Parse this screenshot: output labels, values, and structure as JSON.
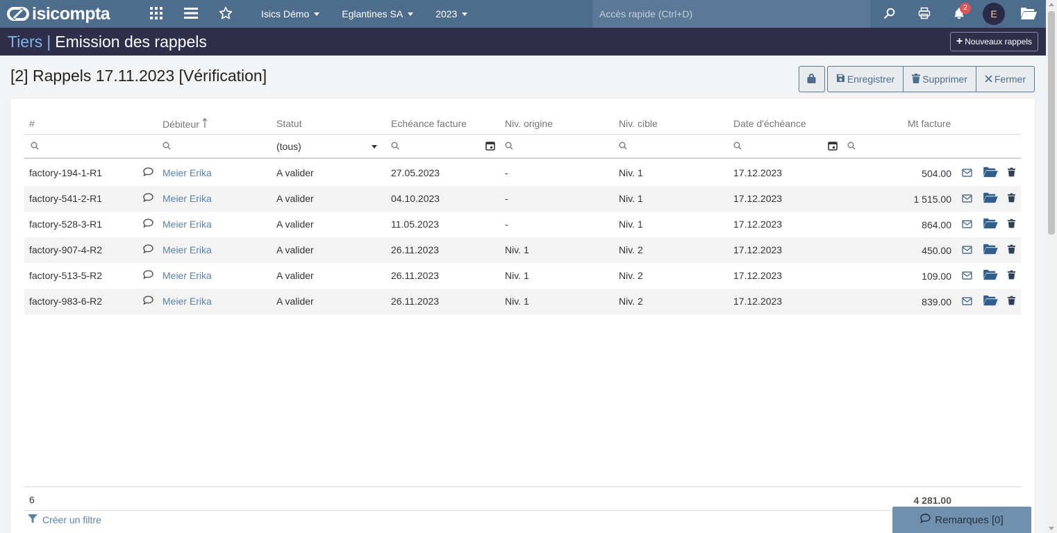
{
  "app": {
    "logo_text": "isicompta"
  },
  "topbar": {
    "dropdowns": [
      "Isics Démo",
      "Eglantines SA",
      "2023"
    ],
    "quick_access_placeholder": "Accès rapide (Ctrl+D)",
    "notification_count": "2",
    "avatar_letter": "E"
  },
  "titlebar": {
    "crumb": "Tiers",
    "separator": "|",
    "title": "Emission des rappels",
    "new_button": "Nouveaux rappels"
  },
  "page": {
    "heading": "[2] Rappels 17.11.2023 [Vérification]"
  },
  "actions": {
    "save": "Enregistrer",
    "delete": "Supprimer",
    "close": "Fermer"
  },
  "table": {
    "columns": [
      "#",
      "Débiteur",
      "Statut",
      "Echéance facture",
      "Niv. origine",
      "Niv. cible",
      "Date d'échéance",
      "Mt facture"
    ],
    "status_filter": "(tous)",
    "rows": [
      {
        "id": "factory-194-1-R1",
        "debtor": "Meier Erika",
        "status": "A valider",
        "due_invoice": "27.05.2023",
        "origin": "-",
        "target": "Niv. 1",
        "due_date": "17.12.2023",
        "amount": "504.00"
      },
      {
        "id": "factory-541-2-R1",
        "debtor": "Meier Erika",
        "status": "A valider",
        "due_invoice": "04.10.2023",
        "origin": "-",
        "target": "Niv. 1",
        "due_date": "17.12.2023",
        "amount": "1 515.00"
      },
      {
        "id": "factory-528-3-R1",
        "debtor": "Meier Erika",
        "status": "A valider",
        "due_invoice": "11.05.2023",
        "origin": "-",
        "target": "Niv. 1",
        "due_date": "17.12.2023",
        "amount": "864.00"
      },
      {
        "id": "factory-907-4-R2",
        "debtor": "Meier Erika",
        "status": "A valider",
        "due_invoice": "26.11.2023",
        "origin": "Niv. 1",
        "target": "Niv. 2",
        "due_date": "17.12.2023",
        "amount": "450.00"
      },
      {
        "id": "factory-513-5-R2",
        "debtor": "Meier Erika",
        "status": "A valider",
        "due_invoice": "26.11.2023",
        "origin": "Niv. 1",
        "target": "Niv. 2",
        "due_date": "17.12.2023",
        "amount": "109.00"
      },
      {
        "id": "factory-983-6-R2",
        "debtor": "Meier Erika",
        "status": "A valider",
        "due_invoice": "26.11.2023",
        "origin": "Niv. 1",
        "target": "Niv. 2",
        "due_date": "17.12.2023",
        "amount": "839.00"
      }
    ],
    "footer": {
      "count": "6",
      "total": "4 281.00"
    }
  },
  "create_filter": "Créer un filtre",
  "remarks": "Remarques [0]",
  "colors": {
    "topbar": "#4e6d8c",
    "titlebar": "#2f2e4b",
    "link": "#5a82a8",
    "badge": "#e05555"
  },
  "icons": [
    "grid-icon",
    "menu-icon",
    "star-icon",
    "search-icon",
    "print-icon",
    "bell-icon",
    "folder-open-icon",
    "lock-icon",
    "save-icon",
    "trash-icon",
    "close-icon",
    "comment-icon",
    "mail-icon",
    "calendar-icon",
    "filter-icon",
    "sort-up-icon"
  ]
}
